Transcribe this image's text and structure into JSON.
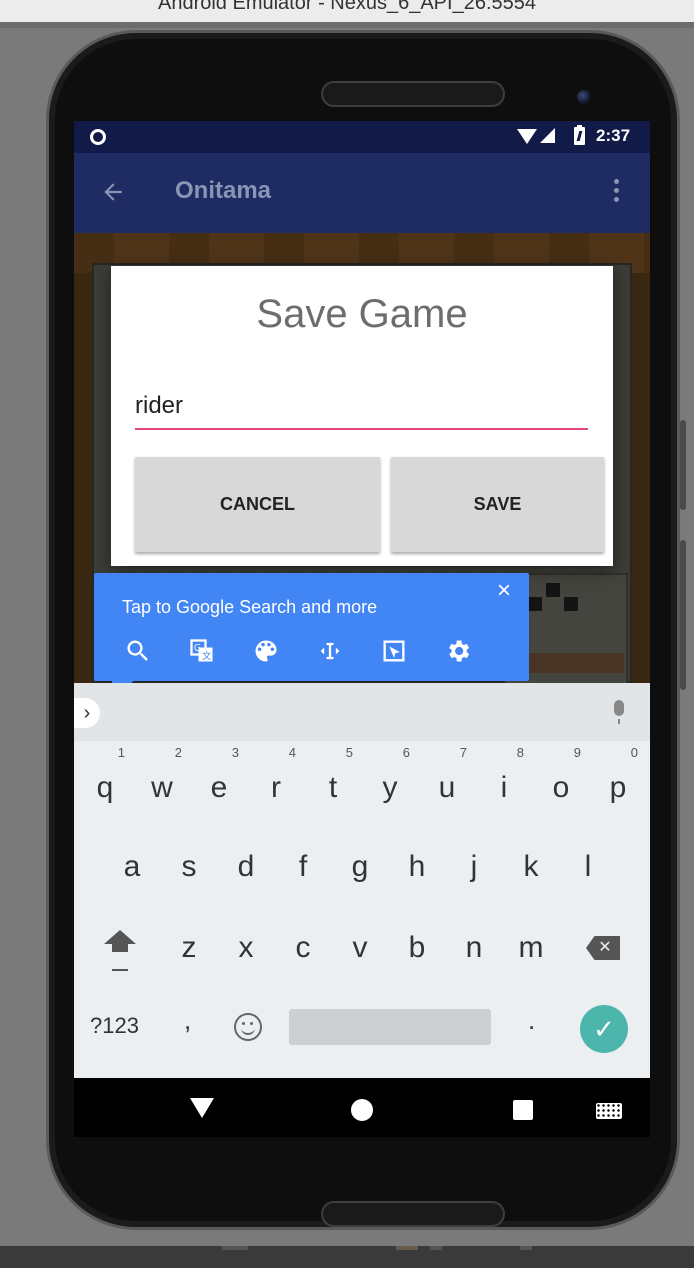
{
  "window": {
    "title": "Android Emulator - Nexus_6_API_26:5554"
  },
  "statusbar": {
    "time": "2:37"
  },
  "appbar": {
    "title": "Onitama"
  },
  "dialog": {
    "title": "Save Game",
    "input_value": "rider",
    "cancel_label": "CANCEL",
    "save_label": "SAVE"
  },
  "assist": {
    "text": "Tap to Google Search and more",
    "close": "×",
    "icons": [
      "search-icon",
      "translate-icon",
      "palette-icon",
      "text-select-icon",
      "screenshot-icon",
      "settings-icon"
    ]
  },
  "keyboard": {
    "row1": [
      {
        "key": "q",
        "hint": "1"
      },
      {
        "key": "w",
        "hint": "2"
      },
      {
        "key": "e",
        "hint": "3"
      },
      {
        "key": "r",
        "hint": "4"
      },
      {
        "key": "t",
        "hint": "5"
      },
      {
        "key": "y",
        "hint": "6"
      },
      {
        "key": "u",
        "hint": "7"
      },
      {
        "key": "i",
        "hint": "8"
      },
      {
        "key": "o",
        "hint": "9"
      },
      {
        "key": "p",
        "hint": "0"
      }
    ],
    "row2": [
      "a",
      "s",
      "d",
      "f",
      "g",
      "h",
      "j",
      "k",
      "l"
    ],
    "row3": [
      "z",
      "x",
      "c",
      "v",
      "b",
      "n",
      "m"
    ],
    "symbols_label": "?123",
    "comma": ",",
    "period": ".",
    "enter": "✓",
    "suggest_chevron": "›"
  },
  "colors": {
    "statusbar": "#121a47",
    "appbar": "#1f2b63",
    "accent": "#e0457d",
    "assist": "#4285f4",
    "enter": "#4db6ac"
  }
}
